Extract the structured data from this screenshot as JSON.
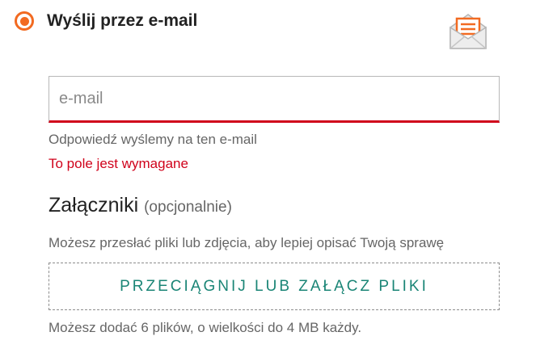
{
  "delivery_option": {
    "label": "Wyślij przez e-mail",
    "selected": true,
    "icon": "envelope-letter-icon"
  },
  "email": {
    "placeholder": "e-mail",
    "value": "",
    "helper": "Odpowiedź wyślemy na ten e-mail",
    "error": "To pole jest wymagane"
  },
  "attachments": {
    "title": "Załączniki",
    "optional_note": "(opcjonalnie)",
    "description": "Możesz przesłać pliki lub zdjęcia, aby lepiej opisać Twoją sprawę",
    "dropzone_label": "PRZECIĄGNIJ LUB ZAŁĄCZ PLIKI",
    "limits": "Możesz dodać 6 plików, o wielkości do 4 MB każdy."
  },
  "colors": {
    "accent": "#f26a21",
    "error": "#d0021b",
    "link": "#1a8576"
  }
}
